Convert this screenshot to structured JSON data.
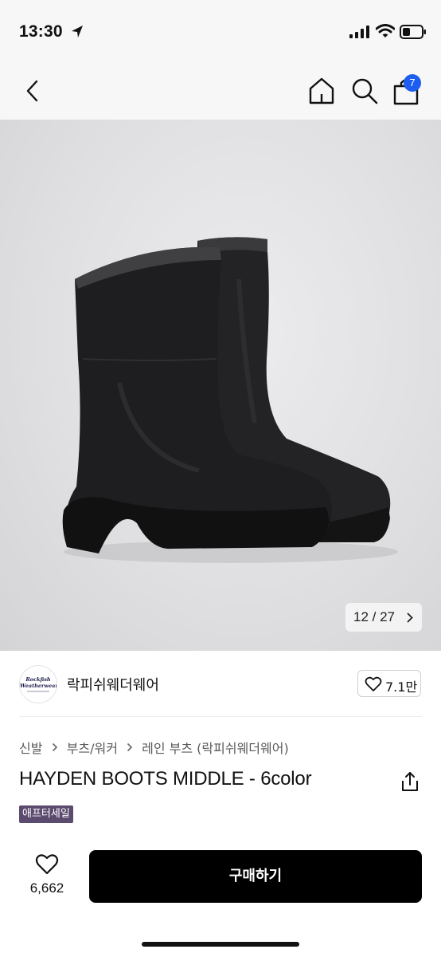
{
  "status_bar": {
    "time": "13:30",
    "icons": [
      "nav-arrow-icon",
      "signal-icon",
      "wifi-icon",
      "battery-icon"
    ]
  },
  "top_nav": {
    "icons": [
      "chevron-left-icon",
      "home-icon",
      "search-icon",
      "shopping-bag-icon"
    ],
    "cart_count": "7",
    "badge_color": "#1d5ef0"
  },
  "gallery": {
    "counter": "12 / 27",
    "image_subject": "black mid-calf rain boots"
  },
  "brand": {
    "logo_line1": "Rockfish",
    "logo_line2": "Weatherwear",
    "name": "락피쉬웨더웨어",
    "like_count": "7.1만"
  },
  "breadcrumb": {
    "items": [
      "신발",
      "부츠/워커",
      "레인 부츠 (락피쉬웨더웨어)"
    ]
  },
  "product": {
    "title": "HAYDEN BOOTS MIDDLE - 6color",
    "badge": "애프터세일",
    "badge_color": "#5b4b6e"
  },
  "bottom_bar": {
    "wish_count": "6,662",
    "buy_label": "구매하기"
  }
}
